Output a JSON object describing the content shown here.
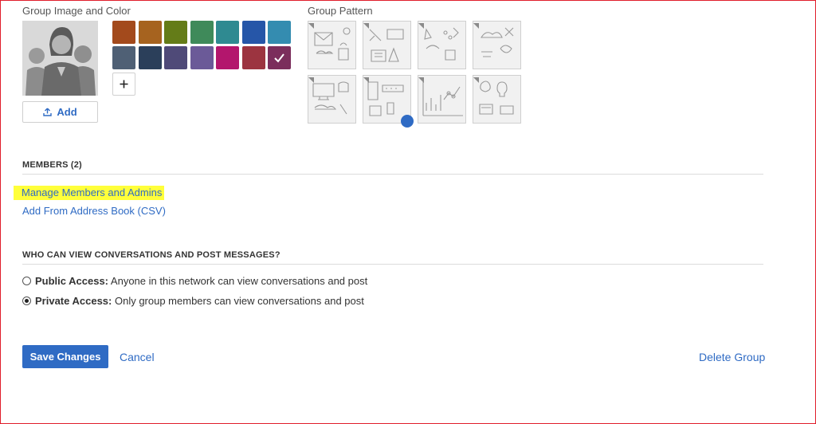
{
  "group_image": {
    "title": "Group Image and Color",
    "add_label": "Add",
    "colors": [
      "#a34a1c",
      "#a6631f",
      "#647c18",
      "#3f8a5a",
      "#2f8a91",
      "#2656a8",
      "#348cb0",
      "#4f6075",
      "#2b3f5a",
      "#4f4a78",
      "#6b5a98",
      "#b3166d",
      "#9c3440",
      "#7b2e5c"
    ],
    "selected_color_index": 13
  },
  "group_pattern": {
    "title": "Group Pattern",
    "selected_index": 5
  },
  "members": {
    "heading": "MEMBERS (2)",
    "manage_link": "Manage Members and Admins",
    "address_book_link": "Add From Address Book (CSV)"
  },
  "access": {
    "heading": "WHO CAN VIEW CONVERSATIONS AND POST MESSAGES?",
    "public_label": "Public Access:",
    "public_desc": "Anyone in this network can view conversations and post",
    "private_label": "Private Access:",
    "private_desc": "Only group members can view conversations and post",
    "selected": "private"
  },
  "actions": {
    "save": "Save Changes",
    "cancel": "Cancel",
    "delete": "Delete Group"
  }
}
